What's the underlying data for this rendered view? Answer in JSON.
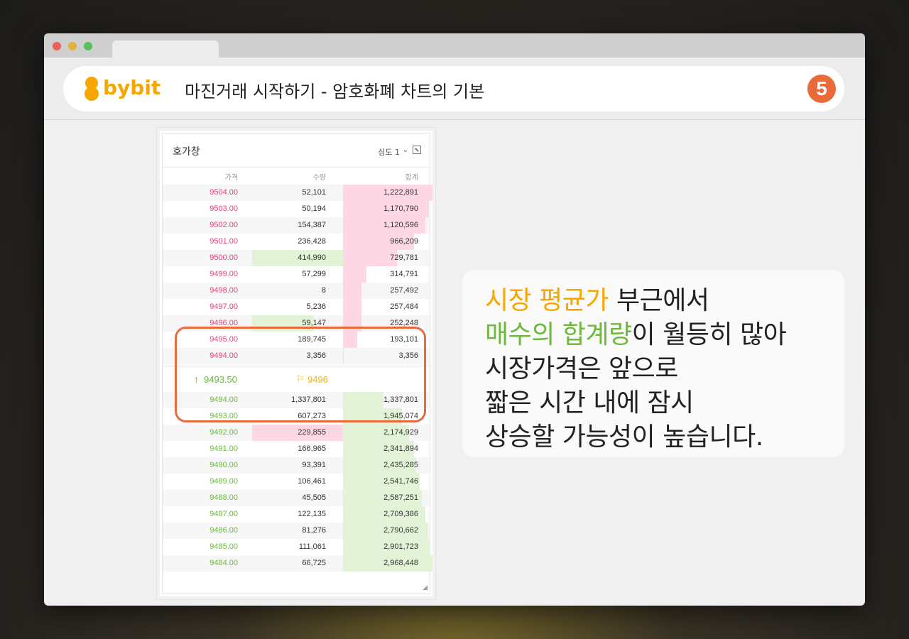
{
  "header": {
    "brand": "bybit",
    "title": "마진거래 시작하기 - 암호화폐 차트의 기본",
    "step": "5"
  },
  "orderbook": {
    "title": "호가창",
    "depth_label": "심도 1",
    "columns": {
      "price": "가격",
      "qty": "수량",
      "total": "합계"
    },
    "sells": [
      {
        "price": "9504.00",
        "qty": "52,101",
        "total": "1,222,891",
        "depth": 1.0,
        "qty_depth": 0
      },
      {
        "price": "9503.00",
        "qty": "50,194",
        "total": "1,170,790",
        "depth": 0.96,
        "qty_depth": 0
      },
      {
        "price": "9502.00",
        "qty": "154,387",
        "total": "1,120,596",
        "depth": 0.92,
        "qty_depth": 0
      },
      {
        "price": "9501.00",
        "qty": "236,428",
        "total": "966,209",
        "depth": 0.79,
        "qty_depth": 0
      },
      {
        "price": "9500.00",
        "qty": "414,990",
        "total": "729,781",
        "depth": 0.6,
        "qty_depth": 1.0
      },
      {
        "price": "9499.00",
        "qty": "57,299",
        "total": "314,791",
        "depth": 0.26,
        "qty_depth": 0
      },
      {
        "price": "9498.00",
        "qty": "8",
        "total": "257,492",
        "depth": 0.21,
        "qty_depth": 0
      },
      {
        "price": "9497.00",
        "qty": "5,236",
        "total": "257,484",
        "depth": 0.21,
        "qty_depth": 0
      },
      {
        "price": "9496.00",
        "qty": "59,147",
        "total": "252,248",
        "depth": 0.21,
        "qty_depth": 0.67
      },
      {
        "price": "9495.00",
        "qty": "189,745",
        "total": "193,101",
        "depth": 0.16,
        "qty_depth": 0
      },
      {
        "price": "9494.00",
        "qty": "3,356",
        "total": "3,356",
        "depth": 0.01,
        "qty_depth": 0
      }
    ],
    "mid": {
      "last_price": "9493.50",
      "mark_price": "9496"
    },
    "buys": [
      {
        "price": "9494.00",
        "qty": "1,337,801",
        "total": "1,337,801",
        "depth": 0.45,
        "qty_depth": 0,
        "qty_color": "green"
      },
      {
        "price": "9493.00",
        "qty": "607,273",
        "total": "1,945,074",
        "depth": 0.66,
        "qty_depth": 0,
        "qty_color": "green"
      },
      {
        "price": "9492.00",
        "qty": "229,855",
        "total": "2,174,929",
        "depth": 0.74,
        "qty_depth": 1.0,
        "qty_color": "pink"
      },
      {
        "price": "9491.00",
        "qty": "166,965",
        "total": "2,341,894",
        "depth": 0.79,
        "qty_depth": 0,
        "qty_color": "green"
      },
      {
        "price": "9490.00",
        "qty": "93,391",
        "total": "2,435,285",
        "depth": 0.82,
        "qty_depth": 0,
        "qty_color": "green"
      },
      {
        "price": "9489.00",
        "qty": "106,461",
        "total": "2,541,746",
        "depth": 0.86,
        "qty_depth": 0,
        "qty_color": "green"
      },
      {
        "price": "9488.00",
        "qty": "45,505",
        "total": "2,587,251",
        "depth": 0.88,
        "qty_depth": 0,
        "qty_color": "green"
      },
      {
        "price": "9487.00",
        "qty": "122,135",
        "total": "2,709,386",
        "depth": 0.92,
        "qty_depth": 0,
        "qty_color": "green"
      },
      {
        "price": "9486.00",
        "qty": "81,276",
        "total": "2,790,662",
        "depth": 0.95,
        "qty_depth": 0,
        "qty_color": "green"
      },
      {
        "price": "9485.00",
        "qty": "111,061",
        "total": "2,901,723",
        "depth": 0.98,
        "qty_depth": 0,
        "qty_color": "green"
      },
      {
        "price": "9484.00",
        "qty": "66,725",
        "total": "2,968,448",
        "depth": 1.0,
        "qty_depth": 0,
        "qty_color": "green"
      }
    ]
  },
  "callout": {
    "line1_highlight": "시장 평균가",
    "line1_rest": " 부근에서",
    "line2_highlight": "매수의 합계량",
    "line2_rest": "이 월등히 많아",
    "line3": "시장가격은 앞으로",
    "line4": "짧은 시간 내에 잠시",
    "line5": "상승할 가능성이 높습니다."
  },
  "colors": {
    "brand": "#f7a600",
    "accent": "#ea6a3a",
    "sell": "#e0457b",
    "buy": "#6db83d",
    "sell_bar": "#fdd7e3",
    "buy_bar": "#e3f3d8"
  }
}
